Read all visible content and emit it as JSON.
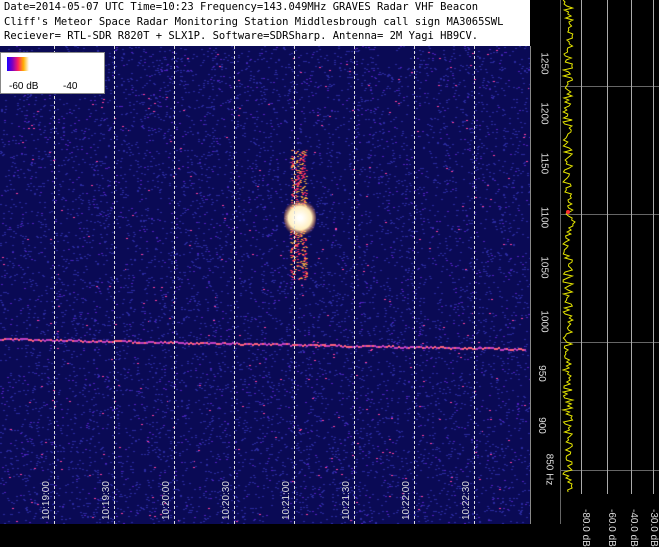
{
  "header": {
    "line1": "Date=2014-05-07 UTC Time=10:23 Frequency=143.049MHz GRAVES Radar VHF Beacon",
    "line2": "Cliff's Meteor Space Radar Monitoring Station Middlesbrough call sign MA3065SWL",
    "line3": "Reciever= RTL-SDR R820T + SLX1P. Software=SDRSharp. Antenna= 2M Yagi HB9CV."
  },
  "scale": {
    "low": "-60 dB",
    "high": "-40"
  },
  "time_labels": [
    "10:19:00",
    "10:19:30",
    "10:20:00",
    "10:20:30",
    "10:21:00",
    "10:21:30",
    "10:22:00",
    "10:22:30"
  ],
  "freq_labels": [
    "1250",
    "1200",
    "1150",
    "1100",
    "1050",
    "1000",
    "950",
    "900",
    "850 Hz"
  ],
  "db_labels": [
    "-80.0 dB",
    "-60.0 dB",
    "-40.0 dB",
    "-30.0 dB"
  ],
  "colors": {
    "background": "#0a0a55",
    "meteor": "#ffffff",
    "carrier": "#ff6060"
  }
}
